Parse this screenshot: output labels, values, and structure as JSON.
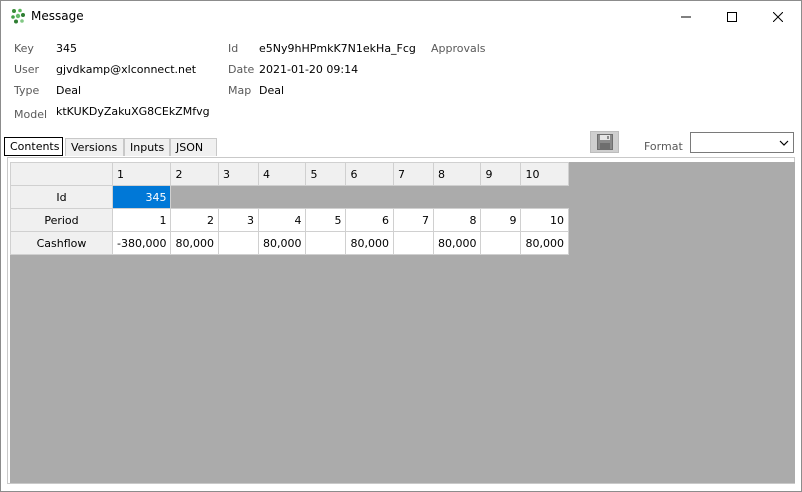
{
  "window": {
    "title": "Message"
  },
  "info": {
    "key_label": "Key",
    "key_value": "345",
    "user_label": "User",
    "user_value": "gjvdkamp@xlconnect.net",
    "type_label": "Type",
    "type_value": "Deal",
    "model_label": "Model",
    "model_value": "ktKUKDyZakuXG8CEkZMfvg",
    "id_label": "Id",
    "id_value": "e5Ny9hHPmkK7N1ekHa_Fcg",
    "date_label": "Date",
    "date_value": "2021-01-20 09:14",
    "map_label": "Map",
    "map_value": "Deal",
    "approvals_label": "Approvals"
  },
  "tabs": [
    "Contents",
    "Versions",
    "Inputs",
    "JSON"
  ],
  "active_tab": "Contents",
  "toolbar": {
    "format_label": "Format",
    "format_value": "",
    "save_icon": "floppy-disk-icon"
  },
  "grid": {
    "columns": [
      "1",
      "2",
      "3",
      "4",
      "5",
      "6",
      "7",
      "8",
      "9",
      "10"
    ],
    "rows": [
      {
        "header": "Id",
        "cells": [
          "345"
        ]
      },
      {
        "header": "Period",
        "cells": [
          "1",
          "2",
          "3",
          "4",
          "5",
          "6",
          "7",
          "8",
          "9",
          "10"
        ]
      },
      {
        "header": "Cashflow",
        "cells": [
          "-380,000",
          "80,000",
          "",
          "80,000",
          "",
          "80,000",
          "",
          "80,000",
          "",
          "80,000"
        ]
      }
    ],
    "selected_cell": "Id,1"
  },
  "colors": {
    "selection": "#0078d7",
    "grid_background": "#ababab",
    "header_background": "#f0f0f0"
  }
}
